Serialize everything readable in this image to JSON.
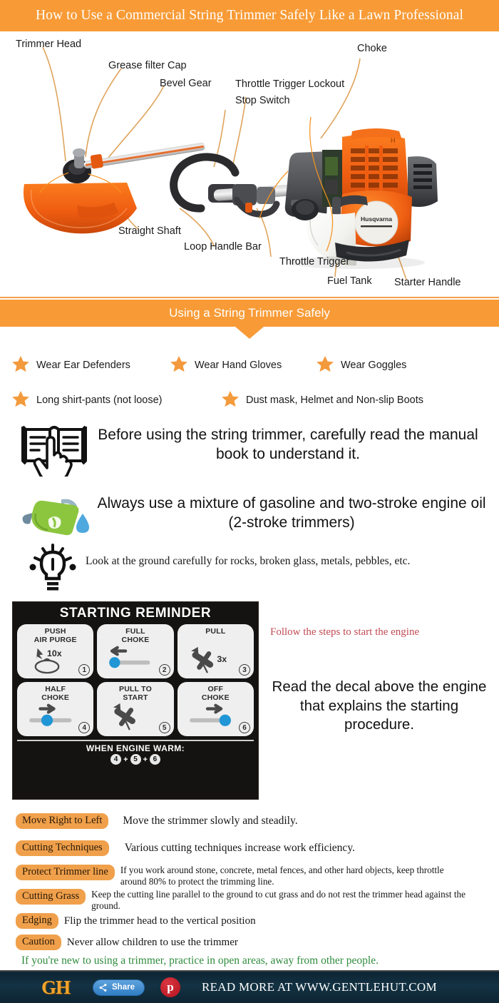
{
  "header": {
    "title": "How to Use a Commercial String Trimmer Safely Like a Lawn Professional",
    "banner_color": "#F89B36"
  },
  "diagram": {
    "labels": [
      {
        "text": "Trimmer Head"
      },
      {
        "text": "Grease filter Cap"
      },
      {
        "text": "Bevel Gear"
      },
      {
        "text": "Throttle Trigger Lockout"
      },
      {
        "text": "Stop Switch"
      },
      {
        "text": "Choke"
      },
      {
        "text": "Straight Shaft"
      },
      {
        "text": "Loop Handle Bar"
      },
      {
        "text": "Throttle Trigger"
      },
      {
        "text": "Fuel Tank"
      },
      {
        "text": "Starter Handle"
      }
    ],
    "brand": "Husqvarna",
    "leader_color": "#E0A45C"
  },
  "safety_section": {
    "banner": "Using a String Trimmer Safely",
    "gear_items": [
      "Wear Ear Defenders",
      "Wear Hand Gloves",
      "Wear Goggles",
      "Long shirt-pants (not loose)",
      "Dust mask, Helmet and Non-slip Boots"
    ],
    "star_color": "#F39A3C"
  },
  "advice_rows": [
    {
      "icon": "open-book-hand-icon",
      "text": "Before using the string trimmer, carefully read the manual book to understand it."
    },
    {
      "icon": "fuel-nozzle-droplet-icon",
      "text": "Always use a mixture of gasoline and two-stroke engine oil (2-stroke trimmers)"
    },
    {
      "icon": "lightbulb-idea-icon",
      "text": "Look at the ground carefully for rocks, broken glass, metals, pebbles, etc."
    }
  ],
  "decal": {
    "title": "STARTING REMINDER",
    "steps": [
      {
        "number": "1",
        "caption_line1": "PUSH",
        "caption_line2": "AIR PURGE",
        "count": "10x",
        "art": "bulb-press"
      },
      {
        "number": "2",
        "caption_line1": "FULL",
        "caption_line2": "CHOKE",
        "count": "",
        "art": "slider-left"
      },
      {
        "number": "3",
        "caption_line1": "PULL",
        "caption_line2": "",
        "count": "3x",
        "art": "pull-cord"
      },
      {
        "number": "4",
        "caption_line1": "HALF",
        "caption_line2": "CHOKE",
        "count": "",
        "art": "slider-mid"
      },
      {
        "number": "5",
        "caption_line1": "PULL TO",
        "caption_line2": "START",
        "count": "",
        "art": "pull-cord"
      },
      {
        "number": "6",
        "caption_line1": "OFF",
        "caption_line2": "CHOKE",
        "count": "",
        "art": "slider-right"
      }
    ],
    "footer_label": "WHEN ENGINE WARM:",
    "warm_sequence": [
      "4",
      "5",
      "6"
    ],
    "warm_plus": "+"
  },
  "decal_side": {
    "follow_text": "Follow the steps to start the engine",
    "follow_color": "#C04B54",
    "read_text": "Read the decal above the engine that explains the starting procedure."
  },
  "tips": [
    {
      "label": "Move Right to Left",
      "text": "Move the strimmer slowly and steadily."
    },
    {
      "label": "Cutting Techniques",
      "text": "Various cutting techniques increase work efficiency."
    },
    {
      "label": "Protect Trimmer line",
      "text": "If you work around stone, concrete, metal fences, and other hard objects, keep throttle around 80% to protect the trimming line."
    },
    {
      "label": "Cutting Grass",
      "text": "Keep the cutting line parallel to the ground to cut grass and do not rest the trimmer head against the ground."
    },
    {
      "label": "Edging",
      "text": "Flip the trimmer head to the vertical position"
    },
    {
      "label": "Caution",
      "text": "Never allow children to use the trimmer"
    }
  ],
  "closing_note": {
    "text": "If you're new to using a trimmer, practice in open areas, away from other people.",
    "color": "#2E8B3C"
  },
  "footer": {
    "logo": "GH",
    "share_label": "Share",
    "pinterest_glyph": "p",
    "read_more": "READ MORE AT WWW.GENTLEHUT.COM",
    "background": "#0d2433"
  }
}
